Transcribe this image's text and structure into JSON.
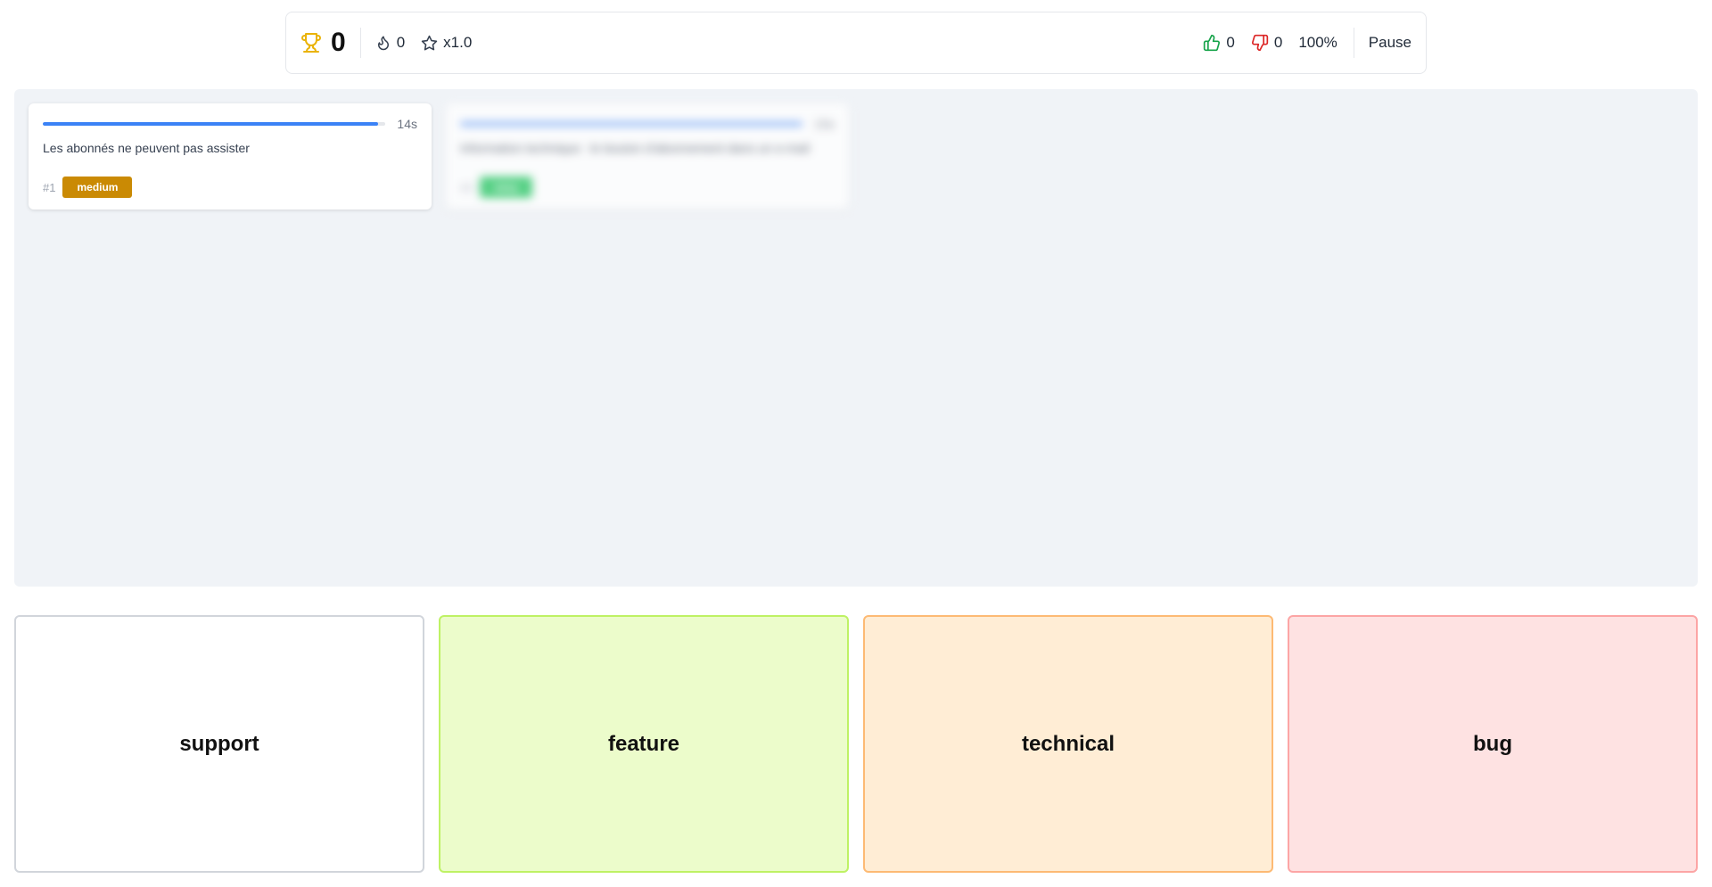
{
  "score": {
    "value": "0"
  },
  "streak": {
    "value": "0"
  },
  "multiplier": {
    "value": "x1.0"
  },
  "correct": {
    "value": "0"
  },
  "wrong": {
    "value": "0"
  },
  "accuracy": {
    "value": "100%"
  },
  "pause_label": "Pause",
  "cards": [
    {
      "time": "14s",
      "progress": 0.98,
      "text": "Les abonnés ne peuvent pas assister",
      "id": "#1",
      "difficulty": "medium",
      "badge_color": "#ca8a04"
    },
    {
      "time": "15s",
      "progress": 1.0,
      "text": "Information technique : le bouton d'abonnement dans un e-mail",
      "id": "#2",
      "difficulty": "easy",
      "badge_color": "#22c55e"
    }
  ],
  "buckets": [
    {
      "label": "support",
      "bg": "#ffffff",
      "border": "#d1d5db"
    },
    {
      "label": "feature",
      "bg": "#ecfccb",
      "border": "#bef264"
    },
    {
      "label": "technical",
      "bg": "#ffedd5",
      "border": "#fdba74"
    },
    {
      "label": "bug",
      "bg": "#fee2e2",
      "border": "#fca5a5"
    }
  ],
  "colors": {
    "trophy": "#eab308",
    "thumbs_up": "#16a34a",
    "thumbs_down": "#dc2626",
    "accent": "#3b82f6"
  },
  "icons": [
    "trophy-icon",
    "flame-icon",
    "star-icon",
    "thumbs-up-icon",
    "thumbs-down-icon"
  ]
}
